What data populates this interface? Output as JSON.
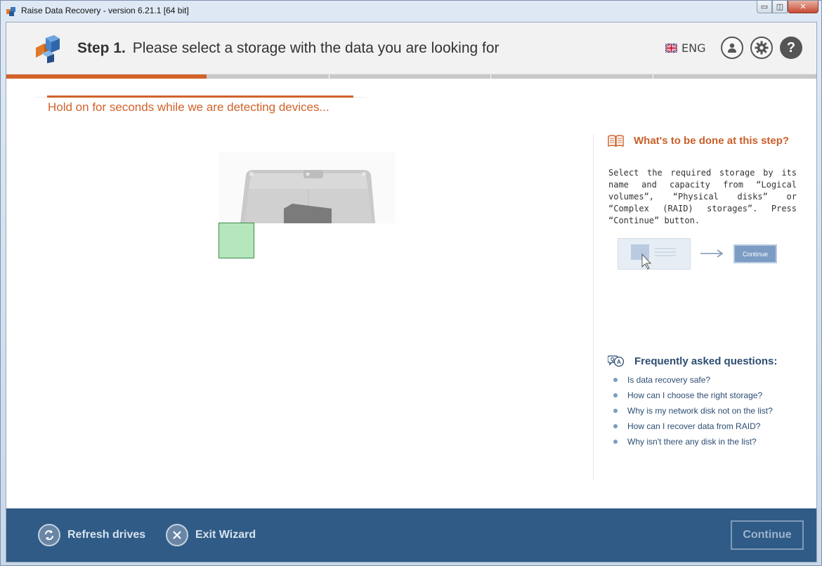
{
  "window": {
    "title": "Raise Data Recovery - version 6.21.1 [64 bit]",
    "controls": {
      "minimize": "▭",
      "restore": "◫",
      "close": "✕"
    }
  },
  "header": {
    "step_label": "Step 1.",
    "step_text": "Please select a storage with the data you are looking for",
    "language": "ENG",
    "help_symbol": "?"
  },
  "wizard_progress": {
    "total_steps": 4,
    "current_step": 1
  },
  "main": {
    "status": "Hold on for seconds while we are detecting devices..."
  },
  "sidebar": {
    "what_title": "What's to be done at this step?",
    "what_text": "Select the required storage by its name and capacity from “Logical volumes”, “Physical disks” or “Complex (RAID) storages”. Press “Continue” button.",
    "illustration_button": "Continue",
    "faq_title": "Frequently asked questions:",
    "faq": [
      "Is data recovery safe?",
      "How can I choose the right storage?",
      "Why is my network disk not on the list?",
      "How can I recover data from RAID?",
      "Why isn't there any disk in the list?"
    ]
  },
  "footer": {
    "refresh": "Refresh drives",
    "exit": "Exit Wizard",
    "continue": "Continue"
  },
  "colors": {
    "accent": "#d1622a",
    "footer": "#2f5b86",
    "faq_link": "#2c4d72"
  },
  "icons": [
    "app-logo-icon",
    "uk-flag-icon",
    "user-icon",
    "gear-icon",
    "help-icon",
    "book-icon",
    "faq-chat-icon",
    "refresh-icon",
    "close-icon",
    "hard-drive-icon"
  ]
}
